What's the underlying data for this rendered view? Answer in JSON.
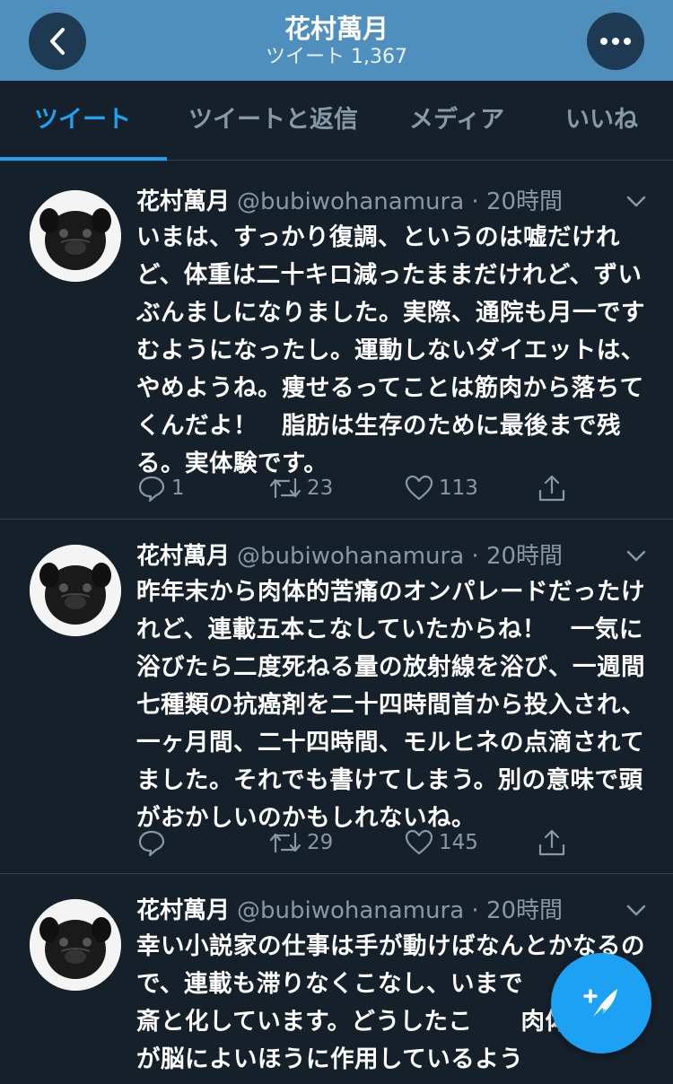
{
  "header": {
    "title": "花村萬月",
    "subtitle": "ツイート 1,367"
  },
  "tabs": [
    {
      "label": "ツイート",
      "active": true
    },
    {
      "label": "ツイートと返信",
      "active": false
    },
    {
      "label": "メディア",
      "active": false
    },
    {
      "label": "いいね",
      "active": false
    }
  ],
  "tweets": [
    {
      "name": "花村萬月",
      "handle": "@bubiwohanamura · 20時間",
      "text": "いまは、すっかり復調、というのは嘘だけれど、体重は二十キロ減ったままだけれど、ずいぶんましになりました。実際、通院も月一ですむようになったし。運動しないダイエットは、やめようね。痩せるってことは筋肉から落ちてくんだよ！　脂肪は生存のために最後まで残る。実体験です。",
      "replies": "1",
      "retweets": "23",
      "likes": "113"
    },
    {
      "name": "花村萬月",
      "handle": "@bubiwohanamura · 20時間",
      "text": "昨年末から肉体的苦痛のオンパレードだったけれど、連載五本こなしていたからね！　一気に浴びたら二度死ねる量の放射線を浴び、一週間七種類の抗癌剤を二十四時間首から投入され、一ヶ月間、二十四時間、モルヒネの点滴されてました。それでも書けてしまう。別の意味で頭がおかしいのかもしれないね。",
      "replies": "",
      "retweets": "29",
      "likes": "145"
    },
    {
      "name": "花村萬月",
      "handle": "@bubiwohanamura · 20時間",
      "text": "幸い小説家の仕事は手が動けばなんとかなるので、連載も滞りなくこなし、いまで　　ドが書斎と化しています。どうしたこ　　肉体の不調が脳によいほうに作用しているよう"
    }
  ],
  "colors": {
    "accent": "#1da1f2",
    "header_bg": "#4f8fbd",
    "background": "#15202b"
  }
}
